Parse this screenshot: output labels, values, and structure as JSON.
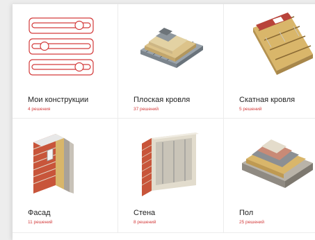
{
  "catalog": {
    "tiles": [
      {
        "title": "Мои конструкции",
        "count": "4 решения",
        "icon": "sliders-icon"
      },
      {
        "title": "Плоская кровля",
        "count": "37 решений",
        "icon": "flat-roof-icon"
      },
      {
        "title": "Скатная кровля",
        "count": "5 решений",
        "icon": "pitched-roof-icon"
      },
      {
        "title": "Фасад",
        "count": "11 решений",
        "icon": "facade-icon"
      },
      {
        "title": "Стена",
        "count": "8 решений",
        "icon": "wall-icon"
      },
      {
        "title": "Пол",
        "count": "25 решений",
        "icon": "floor-icon"
      }
    ]
  },
  "colors": {
    "accent": "#d33a3a",
    "insulation": "#d9b66a",
    "brick": "#c8553a"
  }
}
